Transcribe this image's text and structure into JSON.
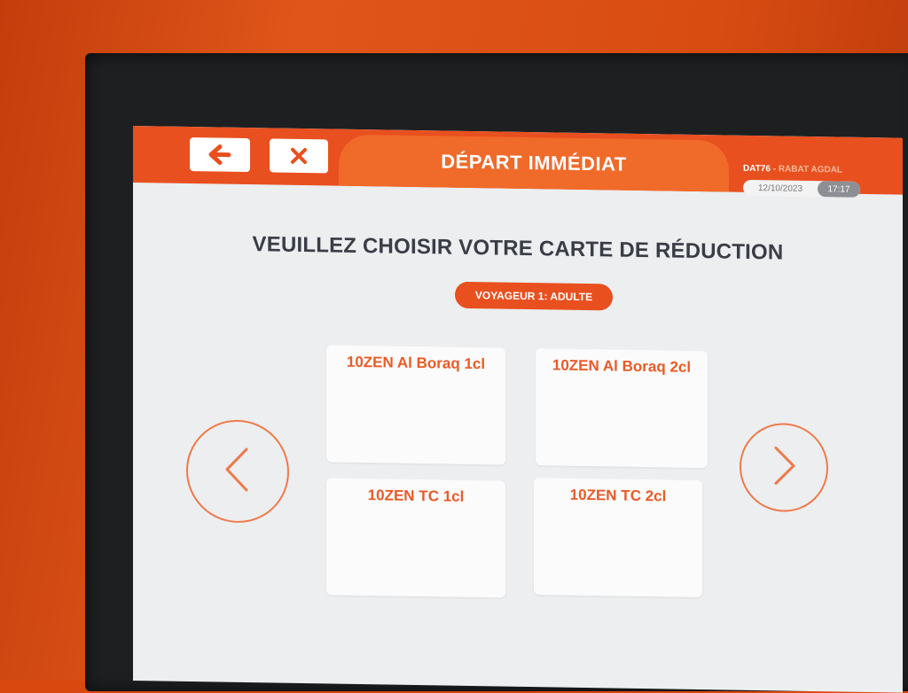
{
  "header": {
    "back_icon": "arrow-left-icon",
    "close_icon": "close-x-icon",
    "title": "DÉPART IMMÉDIAT",
    "station_code": "DAT76",
    "station_sep": " - ",
    "station_name": "RABAT AGDAL",
    "date": "12/10/2023",
    "time": "17:17"
  },
  "main": {
    "heading": "VEUILLEZ CHOISIR VOTRE CARTE DE RÉDUCTION",
    "traveler_badge": "VOYAGEUR 1: ADULTE",
    "cards": [
      {
        "label": "10ZEN Al Boraq 1cl"
      },
      {
        "label": "10ZEN Al Boraq 2cl"
      },
      {
        "label": "10ZEN TC 1cl"
      },
      {
        "label": "10ZEN TC 2cl"
      }
    ],
    "prev_icon": "chevron-left-icon",
    "next_icon": "chevron-right-icon"
  },
  "colors": {
    "accent": "#e8501f",
    "header_pill": "#f06a2a",
    "card_text": "#ea5a26",
    "heading_text": "#3a3d46",
    "screen_bg": "#eceef0",
    "kiosk_body": "#d9480f"
  }
}
